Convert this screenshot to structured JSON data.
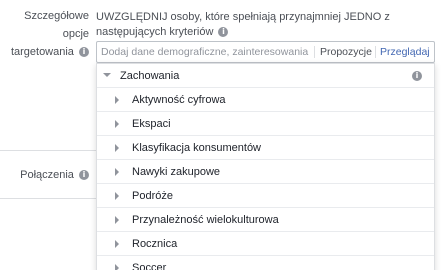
{
  "labels": {
    "detailed_targeting_line1": "Szczegółowe opcje",
    "detailed_targeting_line2": "targetowania",
    "connections": "Połączenia"
  },
  "criteria_text": "UWZGLĘDNIJ osoby, które spełniają przynajmniej JEDNO z następujących kryteriów",
  "search": {
    "placeholder": "Dodaj dane demograficzne, zainteresowania i za...",
    "suggestions_label": "Propozycje",
    "browse_label": "Przeglądaj"
  },
  "dropdown": {
    "header": "Zachowania",
    "items": [
      "Aktywność cyfrowa",
      "Ekspaci",
      "Klasyfikacja konsumentów",
      "Nawyki zakupowe",
      "Podróże",
      "Przynależność wielokulturowa",
      "Rocznica",
      "Soccer"
    ]
  },
  "colors": {
    "link_blue": "#4267b2",
    "text_gray": "#4b4f56",
    "icon_gray": "#90949c"
  }
}
